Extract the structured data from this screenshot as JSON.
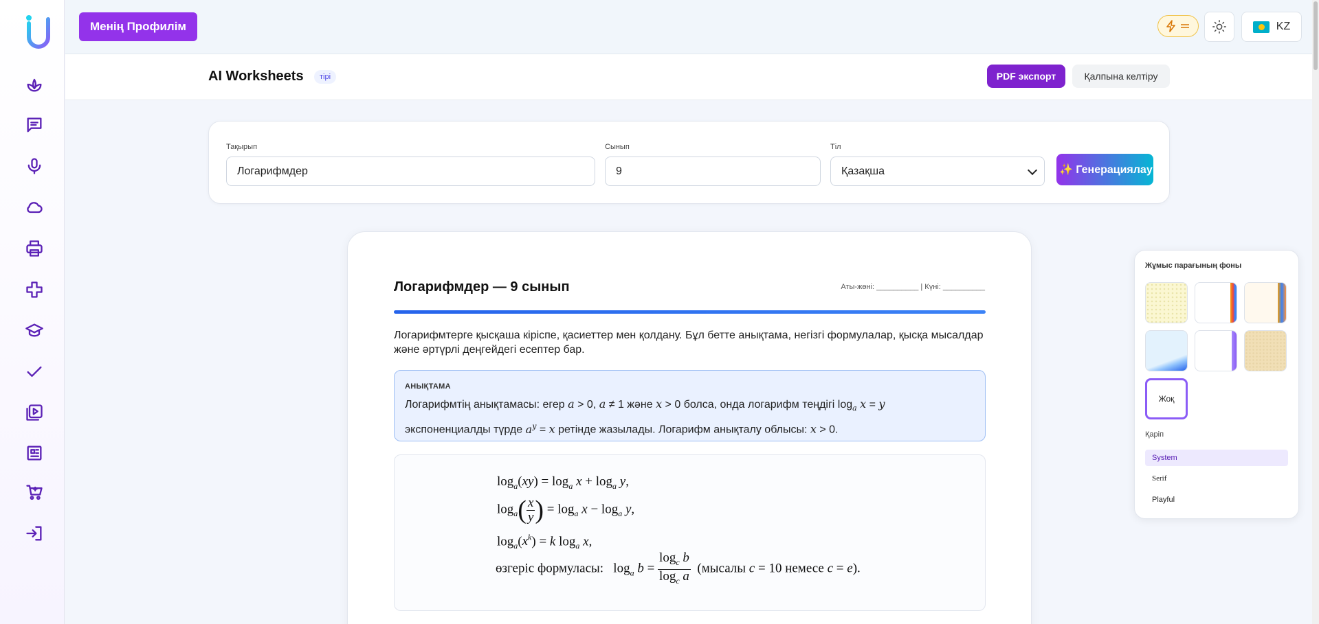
{
  "topbar": {
    "profile_label": "Менің Профилім",
    "energy_icon": "lightning-icon",
    "theme_icon": "sun-icon",
    "lang_label": "KZ"
  },
  "sidebar": {
    "icons": [
      "lotus-icon",
      "chat-icon",
      "microphone-icon",
      "cloud-icon",
      "printer-icon",
      "gamepad-icon",
      "graduation-cap-icon",
      "check-icon",
      "video-library-icon",
      "newspaper-icon",
      "cart-icon",
      "login-icon"
    ]
  },
  "header": {
    "title": "AI Worksheets",
    "badge": "тірі",
    "pdf_label": "PDF экспорт",
    "reset_label": "Қалпына келтіру"
  },
  "form": {
    "topic_label": "Тақырып",
    "topic_value": "Логарифмдер",
    "grade_label": "Сынып",
    "grade_value": "9",
    "lang_label": "Тіл",
    "lang_value": "Қазақша",
    "generate_label": "✨ Генерациялау"
  },
  "worksheet": {
    "title": "Логарифмдер — 9 сынып",
    "meta": "Аты-жөні: __________ | Күні: __________",
    "intro": "Логарифмтерге қысқаша кіріспе, қасиеттер мен қолдану. Бұл бетте анықтама, негізгі формулалар, қысқа мысалдар және әртүрлі деңгейдегі есептер бар.",
    "def_heading": "АНЫҚТАМА",
    "def_p1": "Логарифмтің анықтамасы: егер ",
    "def_p2": " және ",
    "def_p3": " болса, онда логарифм теңдігі ",
    "def_p4": "экспоненциалды түрде ",
    "def_p5": " ретінде жазылады. Логарифм анықталу облысы: ",
    "f4_label": "өзгеріс формуласы:",
    "f4_note_a": "(мысалы ",
    "f4_note_b": " немесе "
  },
  "bg_panel": {
    "title": "Жұмыс парағының фоны",
    "none_label": "Жоқ",
    "font_label": "Қаріп",
    "fonts": [
      "System",
      "Serif",
      "Playful"
    ]
  },
  "colors": {
    "accent": "#9333ea",
    "nav": "#5b21b6",
    "def_bg": "#eaf1ff",
    "bar": "#2563eb"
  }
}
